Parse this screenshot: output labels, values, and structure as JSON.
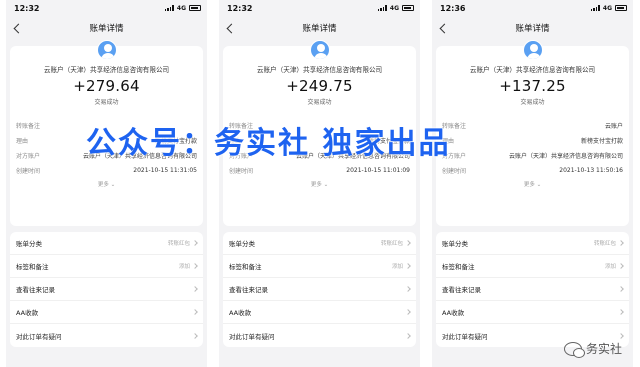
{
  "nav_title": "账单详情",
  "payee": "云账户（天津）共享经济信息咨询有限公司",
  "tx_status": "交易成功",
  "more_label": "更多",
  "phones": [
    {
      "time": "12:32",
      "network": "4G",
      "amount": "+279.64",
      "details": [
        {
          "label": "转账备注",
          "value": ""
        },
        {
          "label": "理由",
          "value": "新榜支付宝打款"
        },
        {
          "label": "对方账户",
          "value": "云账户（天津）共享经济信息咨询有限公司"
        },
        {
          "label": "创建时间",
          "value": "2021-10-15 11:31:05"
        }
      ],
      "list": [
        {
          "label": "账单分类",
          "value": "转账红包"
        },
        {
          "label": "标签和备注",
          "value": "添加"
        },
        {
          "label": "查看往来记录",
          "value": ""
        },
        {
          "label": "AA收款",
          "value": ""
        },
        {
          "label": "对此订单有疑问",
          "value": ""
        }
      ]
    },
    {
      "time": "12:32",
      "network": "4G",
      "amount": "+249.75",
      "details": [
        {
          "label": "转账备注",
          "value": ""
        },
        {
          "label": "理由",
          "value": "新榜支付宝打款"
        },
        {
          "label": "对方账户",
          "value": "云账户（天津）共享经济信息咨询有限公司"
        },
        {
          "label": "创建时间",
          "value": "2021-10-15 11:01:09"
        }
      ],
      "list": [
        {
          "label": "账单分类",
          "value": "转账红包"
        },
        {
          "label": "标签和备注",
          "value": "添加"
        },
        {
          "label": "查看往来记录",
          "value": ""
        },
        {
          "label": "AA收款",
          "value": ""
        },
        {
          "label": "对此订单有疑问",
          "value": ""
        }
      ]
    },
    {
      "time": "12:36",
      "network": "4G",
      "amount": "+137.25",
      "details": [
        {
          "label": "转账备注",
          "value": "云账户"
        },
        {
          "label": "理由",
          "value": "新榜支付宝打款"
        },
        {
          "label": "对方账户",
          "value": "云账户（天津）共享经济信息咨询有限公司"
        },
        {
          "label": "创建时间",
          "value": "2021-10-13 11:50:16"
        }
      ],
      "list": [
        {
          "label": "账单分类",
          "value": "转账红包"
        },
        {
          "label": "标签和备注",
          "value": "添加"
        },
        {
          "label": "查看往来记录",
          "value": ""
        },
        {
          "label": "AA收款",
          "value": ""
        },
        {
          "label": "对此订单有疑问",
          "value": ""
        }
      ]
    }
  ],
  "overlay_text": "公众号：务实社 独家出品",
  "watermark_text": "务实社"
}
